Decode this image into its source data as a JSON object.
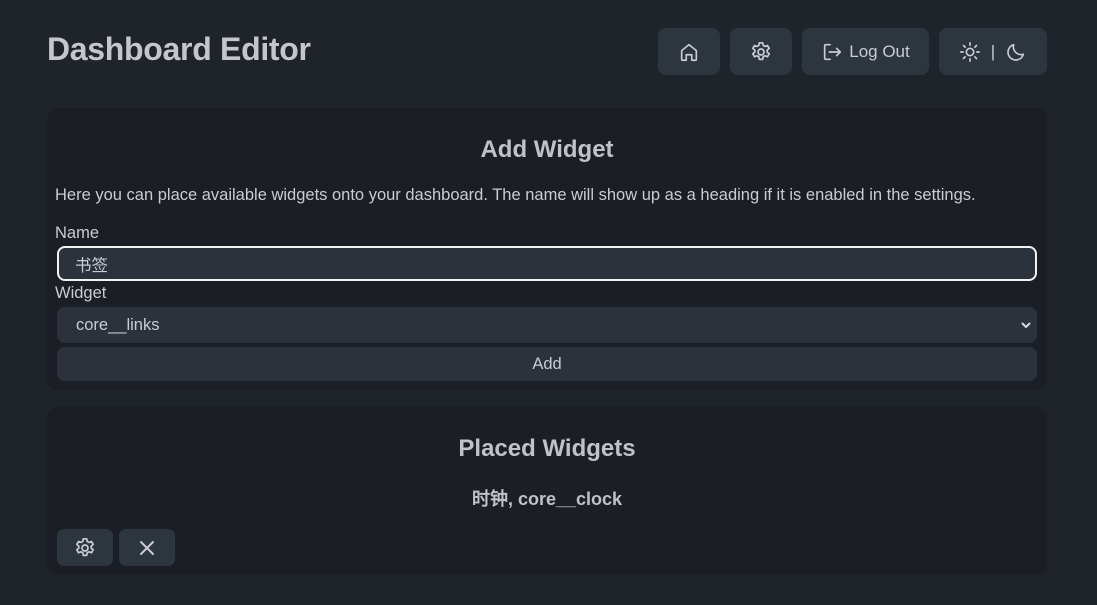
{
  "header": {
    "title": "Dashboard Editor",
    "buttons": {
      "home_icon": "home-icon",
      "settings_icon": "gear-icon",
      "logout_label": "Log Out",
      "theme_separator": "|"
    }
  },
  "add_widget": {
    "heading": "Add Widget",
    "description": "Here you can place available widgets onto your dashboard. The name will show up as a heading if it is enabled in the settings.",
    "name_label": "Name",
    "name_value": "书签",
    "widget_label": "Widget",
    "widget_selected": "core__links",
    "add_label": "Add"
  },
  "placed_widgets": {
    "heading": "Placed Widgets",
    "items": [
      {
        "title": "时钟, core__clock"
      }
    ]
  },
  "colors": {
    "background": "#1f242b",
    "card": "#1b1f25",
    "control": "#2b323c",
    "text": "#c9ccd1"
  }
}
